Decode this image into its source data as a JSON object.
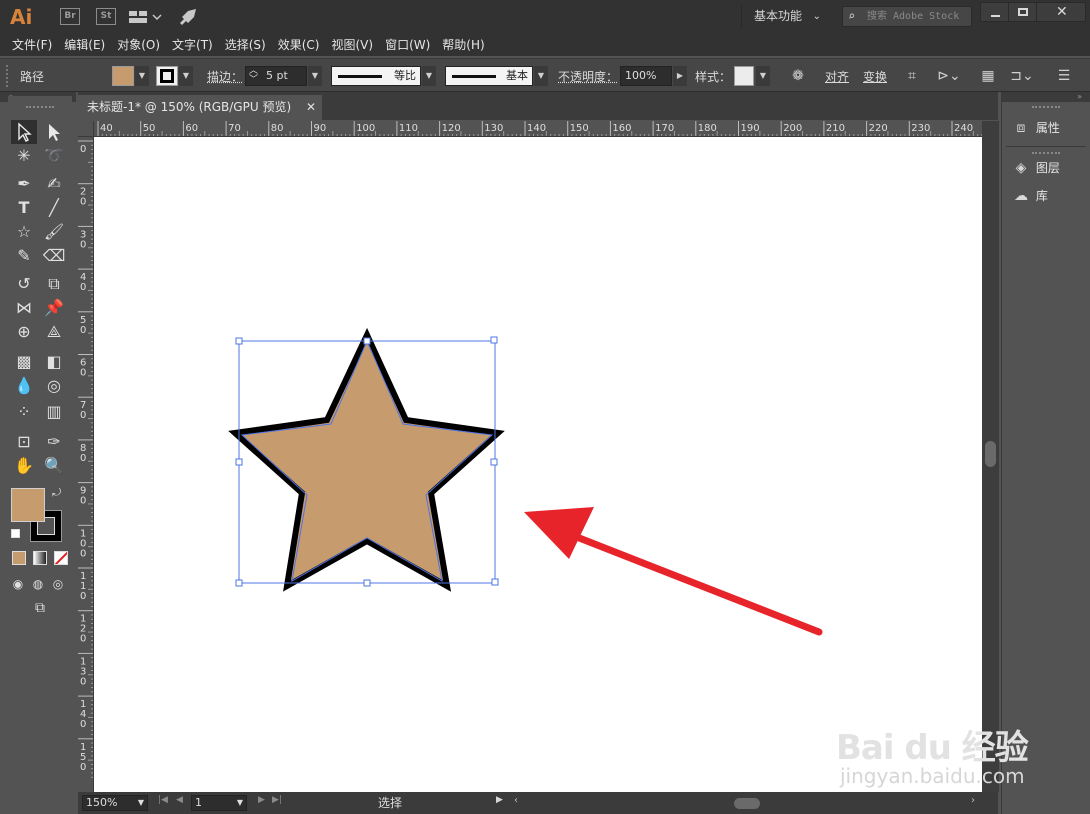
{
  "app": {
    "logo": "Ai",
    "bridge_buttons": [
      "Br",
      "St"
    ],
    "workspace_label": "基本功能",
    "search_placeholder": "搜索 Adobe Stock"
  },
  "menu": [
    "文件(F)",
    "编辑(E)",
    "对象(O)",
    "文字(T)",
    "选择(S)",
    "效果(C)",
    "视图(V)",
    "窗口(W)",
    "帮助(H)"
  ],
  "control_bar": {
    "selection_type": "路径",
    "stroke_label": "描边：",
    "stroke_weight": "5 pt",
    "variable_width_profile": "等比",
    "brush_definition": "基本",
    "opacity_label": "不透明度：",
    "opacity_value": "100%",
    "style_label": "样式：",
    "align_label": "对齐",
    "transform_label": "变换",
    "fill_color": "#c69b6d",
    "stroke_color": "#000000"
  },
  "document": {
    "tab_title": "未标题-1* @ 150% (RGB/GPU 预览)",
    "close_glyph": "✕"
  },
  "rulers": {
    "horizontal_ticks": [
      "40",
      "50",
      "60",
      "70",
      "80",
      "90",
      "100",
      "110",
      "120",
      "130",
      "140",
      "150",
      "160",
      "170",
      "180",
      "190",
      "200",
      "210",
      "220",
      "230",
      "240"
    ],
    "vertical_ticks": [
      "0",
      "20",
      "30",
      "40",
      "50",
      "60",
      "70",
      "80",
      "90",
      "100",
      "110",
      "120",
      "130",
      "140",
      "150"
    ]
  },
  "status_bar": {
    "zoom": "150%",
    "artboard_number": "1",
    "tool_status": "选择"
  },
  "panels": [
    {
      "label": "属性",
      "icon": "properties-icon"
    },
    {
      "label": "图层",
      "icon": "layers-icon"
    },
    {
      "label": "库",
      "icon": "libraries-icon"
    }
  ],
  "artwork": {
    "star_fill": "#c69b6d",
    "star_stroke": "#000000",
    "selection_color": "#4f74e4",
    "arrow_color": "#e8242b"
  },
  "watermark": {
    "logo_text": "Bai du 经验",
    "url_text": "jingyan.baidu.com"
  }
}
